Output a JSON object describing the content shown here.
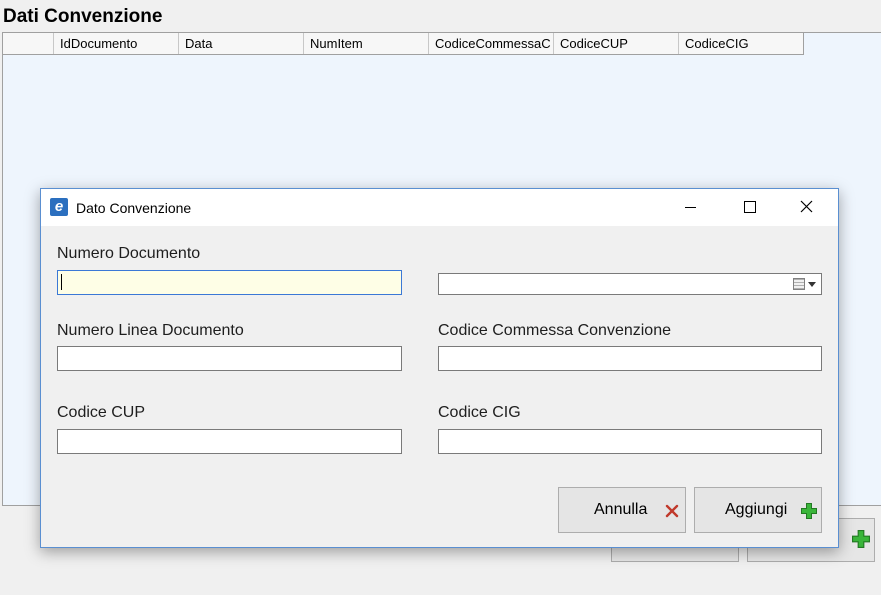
{
  "page": {
    "title": "Dati Convenzione",
    "grid_columns": [
      "",
      "IdDocumento",
      "Data",
      "NumItem",
      "CodiceCommessaC",
      "CodiceCUP",
      "CodiceCIG"
    ]
  },
  "dialog": {
    "title": "Dato Convenzione",
    "icon_label": "e",
    "fields": {
      "numero_documento": {
        "label": "Numero Documento",
        "value": ""
      },
      "data": {
        "value": ""
      },
      "numero_linea": {
        "label": "Numero Linea Documento",
        "value": ""
      },
      "codice_commessa": {
        "label": "Codice Commessa Convenzione",
        "value": ""
      },
      "codice_cup": {
        "label": "Codice CUP",
        "value": ""
      },
      "codice_cig": {
        "label": "Codice CIG",
        "value": ""
      }
    },
    "buttons": {
      "annulla": "Annulla",
      "aggiungi": "Aggiungi"
    }
  },
  "colors": {
    "accent": "#3b78d6",
    "cancel_icon": "#c0392b",
    "add_icon": "#3ab53a",
    "grid_bg": "#eef5fd"
  },
  "icons": [
    "app-e-icon",
    "minimize-icon",
    "maximize-icon",
    "close-icon",
    "calendar-icon",
    "chevron-down-icon",
    "cancel-x-icon",
    "add-plus-icon"
  ]
}
